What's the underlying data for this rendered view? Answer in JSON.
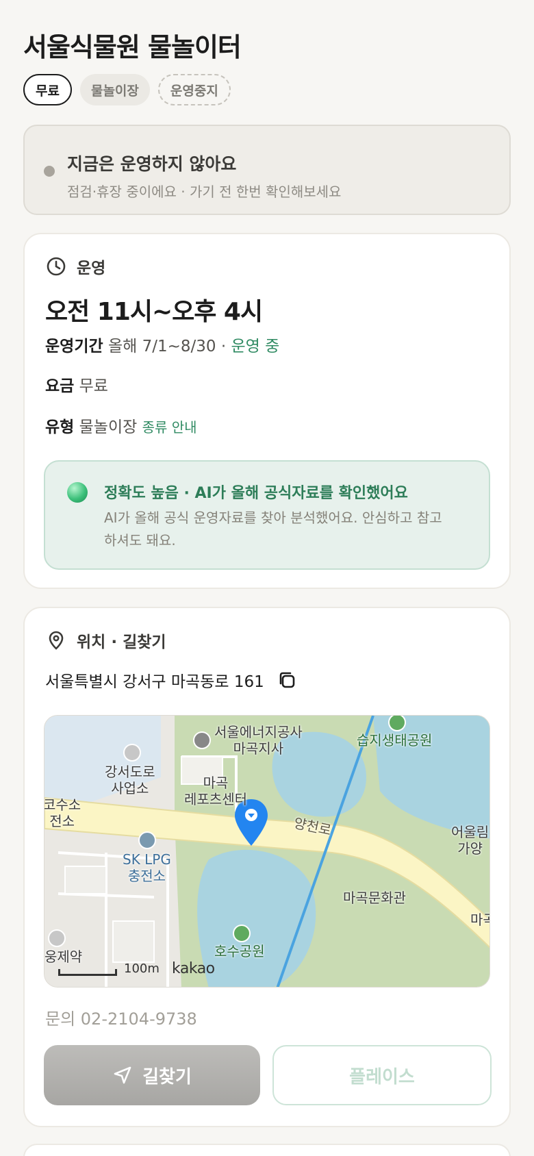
{
  "place": {
    "title": "서울식물원 물놀이터",
    "tags": {
      "fee": "무료",
      "type": "물놀이장",
      "status": "운영중지"
    }
  },
  "status_card": {
    "title": "지금은 운영하지 않아요",
    "subtitle": "점검·휴장 중이에요 · 가기 전 한번 확인해보세요"
  },
  "hours": {
    "section_label": "운영",
    "time_range": "오전 11시~오후 4시",
    "period_label": "운영기간",
    "period_value": "올해 7/1~8/30 ·",
    "period_status": "운영 중",
    "fee_label": "요금",
    "fee_value": "무료",
    "type_label": "유형",
    "type_value": "물놀이장",
    "type_link": "종류 안내",
    "ai": {
      "title": "정확도 높음 · AI가 올해 공식자료를 확인했어요",
      "description": "AI가 올해 공식 운영자료를 찾아 분석했어요. 안심하고 참고하셔도 돼요."
    }
  },
  "location": {
    "section_label": "위치 · 길찾기",
    "address": "서울특별시 강서구 마곡동로 161",
    "map": {
      "labels": {
        "energy": "서울에너지공사\n마곡지사",
        "wetland": "습지생태공원",
        "road_office": "강서도로\n사업소",
        "sports": "마곡\n레포츠센터",
        "hydrogen": "코수소\n전소",
        "yangcheon": "양천로",
        "lpg": "SK LPG\n충전소",
        "culture": "마곡문화관",
        "lake": "호수공원",
        "pharmacy": "웅제약",
        "park_edge": "어울림\n가양",
        "edge_right": "마곡"
      },
      "scale": "100m",
      "provider": "kakao"
    },
    "contact": "문의 02-2104-9738",
    "directions_button": "길찾기",
    "place_button": "플레이스"
  },
  "colors": {
    "accent_green": "#2f8a62",
    "status_gray": "#a8a49c"
  }
}
